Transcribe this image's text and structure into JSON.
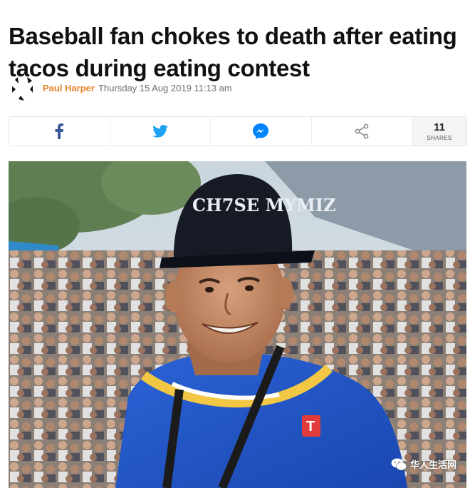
{
  "article": {
    "headline": "Baseball fan chokes to death after eating tacos during eating contest",
    "author": "Paul Harper",
    "date": "Thursday 15 Aug 2019 11:13 am"
  },
  "share_bar": {
    "buttons": [
      {
        "icon": "facebook-icon",
        "color": "#3b5998"
      },
      {
        "icon": "twitter-icon",
        "color": "#1da1f2"
      },
      {
        "icon": "messenger-icon",
        "color": "#0084ff"
      },
      {
        "icon": "share-icon",
        "color": "#888888"
      }
    ],
    "count": "11",
    "count_label": "SHARES"
  },
  "photo": {
    "cap_text": "CH7SE MYMIZ",
    "watermark": "华人生活网"
  },
  "colors": {
    "author": "#e8832a",
    "jersey": "#1f56c9",
    "cap": "#151a24"
  }
}
